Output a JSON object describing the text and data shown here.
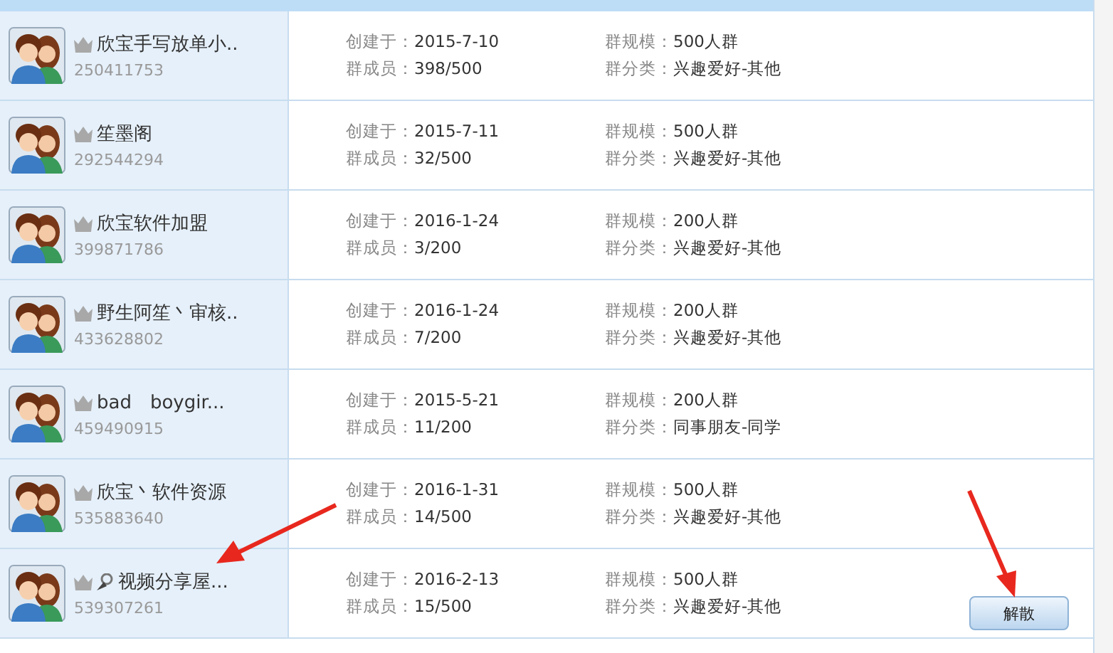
{
  "groups": [
    {
      "name": "欣宝手写放单小..",
      "number": "250411753",
      "created_label": "创建于：",
      "created": "2015-7-10",
      "members_label": "群成员：",
      "members": "398/500",
      "size_label": "群规模：",
      "size": "500人群",
      "category_label": "群分类：",
      "category": "兴趣爱好-其他",
      "video_icon": false
    },
    {
      "name": "笙墨阁",
      "number": "292544294",
      "created_label": "创建于：",
      "created": "2015-7-11",
      "members_label": "群成员：",
      "members": "32/500",
      "size_label": "群规模：",
      "size": "500人群",
      "category_label": "群分类：",
      "category": "兴趣爱好-其他",
      "video_icon": false
    },
    {
      "name": "欣宝软件加盟",
      "number": "399871786",
      "created_label": "创建于：",
      "created": "2016-1-24",
      "members_label": "群成员：",
      "members": "3/200",
      "size_label": "群规模：",
      "size": "200人群",
      "category_label": "群分类：",
      "category": "兴趣爱好-其他",
      "video_icon": false
    },
    {
      "name": "野生阿笙丶审核..",
      "number": "433628802",
      "created_label": "创建于：",
      "created": "2016-1-24",
      "members_label": "群成员：",
      "members": "7/200",
      "size_label": "群规模：",
      "size": "200人群",
      "category_label": "群分类：",
      "category": "兴趣爱好-其他",
      "video_icon": false
    },
    {
      "name": "bad　boygir...",
      "number": "459490915",
      "created_label": "创建于：",
      "created": "2015-5-21",
      "members_label": "群成员：",
      "members": "11/200",
      "size_label": "群规模：",
      "size": "200人群",
      "category_label": "群分类：",
      "category": "同事朋友-同学",
      "video_icon": false
    },
    {
      "name": "欣宝丶软件资源",
      "number": "535883640",
      "created_label": "创建于：",
      "created": "2016-1-31",
      "members_label": "群成员：",
      "members": "14/500",
      "size_label": "群规模：",
      "size": "500人群",
      "category_label": "群分类：",
      "category": "兴趣爱好-其他",
      "video_icon": false
    },
    {
      "name": "视频分享屋...",
      "number": "539307261",
      "created_label": "创建于：",
      "created": "2016-2-13",
      "members_label": "群成员：",
      "members": "15/500",
      "size_label": "群规模：",
      "size": "500人群",
      "category_label": "群分类：",
      "category": "兴趣爱好-其他",
      "video_icon": true,
      "button": "解散"
    }
  ]
}
